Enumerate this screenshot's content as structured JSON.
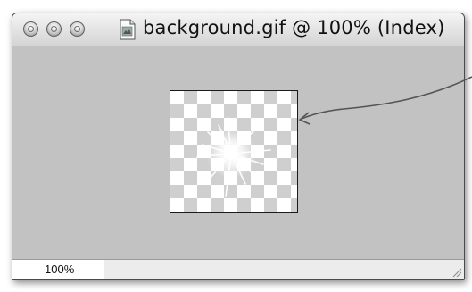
{
  "window": {
    "title": "background.gif @ 100% (Index)",
    "buttons": [
      "close-icon",
      "minimize-icon",
      "zoom-icon"
    ],
    "doc_icon": "gif-document-icon"
  },
  "statusbar": {
    "zoom_value": "100%"
  },
  "colors": {
    "canvas_bg": "#c2c2c2",
    "checker_light": "#ffffff",
    "checker_dark": "#cfcfcf",
    "annotation_arrow": "#555555"
  }
}
